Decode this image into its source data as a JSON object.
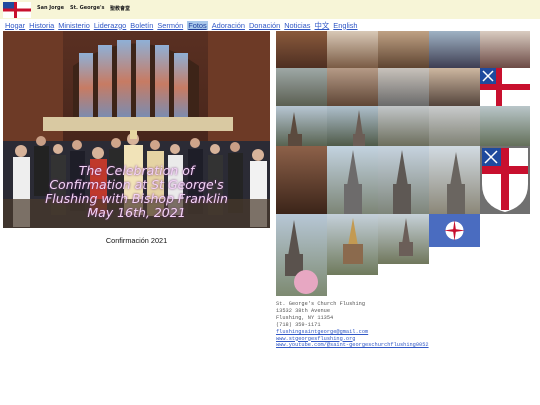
{
  "header": {
    "names": [
      "San Jorge",
      "St. George's",
      "聖教會堂"
    ]
  },
  "nav": {
    "items": [
      {
        "label": "Hogar",
        "active": false
      },
      {
        "label": "Historia",
        "active": false
      },
      {
        "label": "Ministerio",
        "active": false
      },
      {
        "label": "Liderazgo",
        "active": false
      },
      {
        "label": "Boletín",
        "active": false
      },
      {
        "label": "Sermón",
        "active": false
      },
      {
        "label": "Fotos",
        "active": true
      },
      {
        "label": "Adoración",
        "active": false
      },
      {
        "label": "Donación",
        "active": false
      },
      {
        "label": "Noticias",
        "active": false
      },
      {
        "label": "中文",
        "active": false
      },
      {
        "label": "English",
        "active": false
      }
    ]
  },
  "feature": {
    "overlay_lines": [
      "The Celebration of",
      "Confirmation at St George's",
      "Flushing with Bishop Franklin",
      "May 16th, 2021"
    ],
    "caption": "Confirmación 2021"
  },
  "contact": {
    "name": "St. George's Church Flushing",
    "address1": "13532 38th Avenue",
    "address2": "Flushing, NY 11354",
    "phone": "(718) 359-1171",
    "email": "flushingsaintgeorge@gmail.com",
    "website": "www.stgeorgesflushing.org",
    "youtube": "www.youtube.com/@saint-georgeschurchflushing0052"
  },
  "colors": {
    "header_bg": "#f7f5d7",
    "link": "#3158c6",
    "active_tab": "#a9c8ea",
    "episcopal_blue": "#1f4a9e",
    "episcopal_red": "#c8102e"
  }
}
